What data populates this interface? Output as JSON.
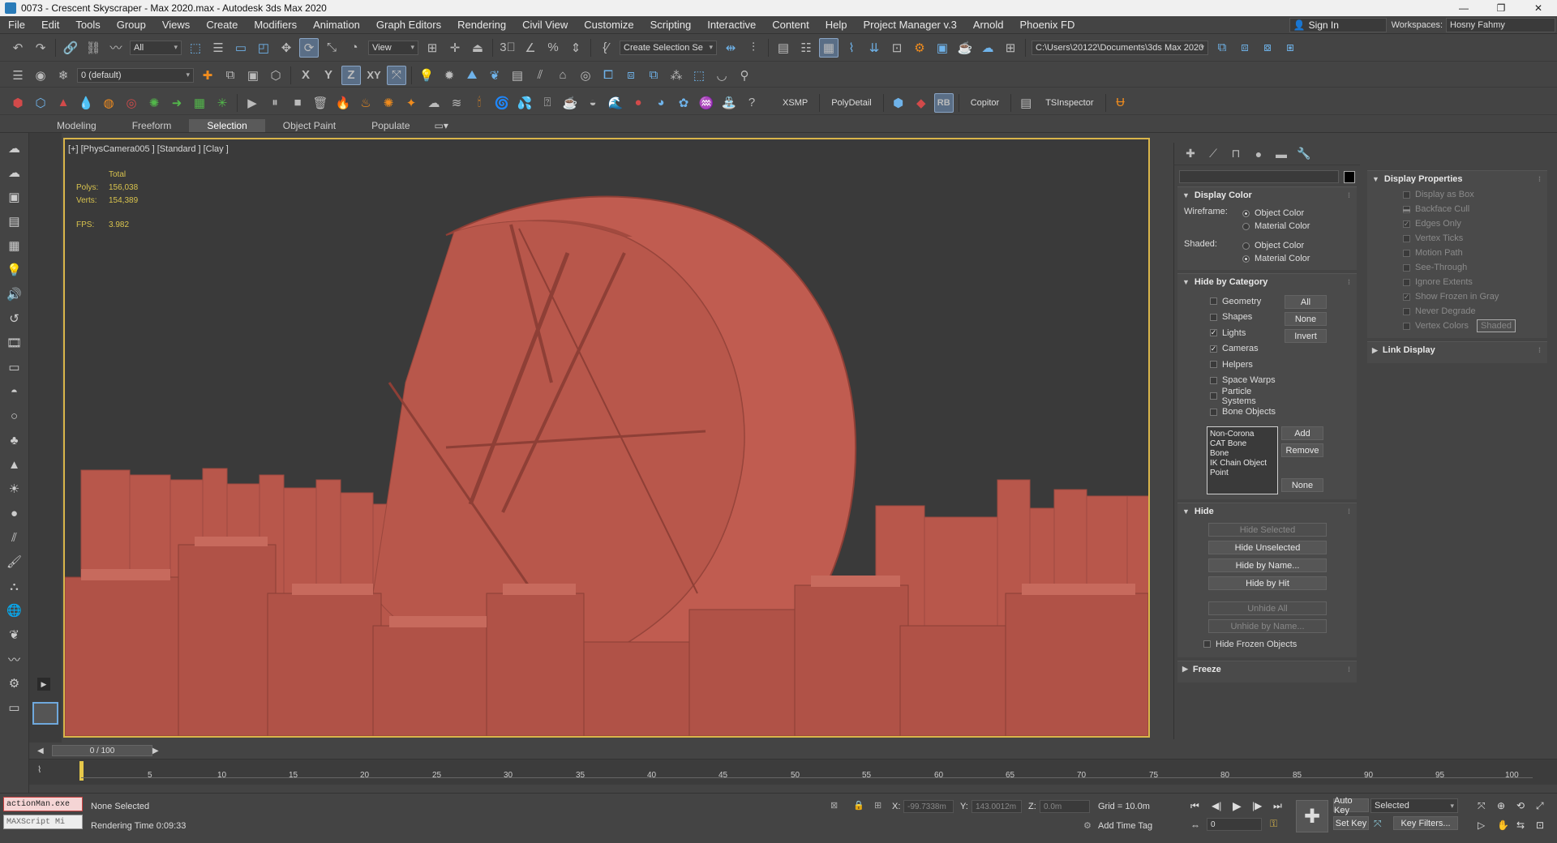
{
  "window": {
    "title": "0073 - Crescent Skyscraper - Max 2020.max - Autodesk 3ds Max 2020",
    "controls": [
      "—",
      "❐",
      "✕"
    ]
  },
  "menu": {
    "items": [
      "File",
      "Edit",
      "Tools",
      "Group",
      "Views",
      "Create",
      "Modifiers",
      "Animation",
      "Graph Editors",
      "Rendering",
      "Civil View",
      "Customize",
      "Scripting",
      "Interactive",
      "Content",
      "Help",
      "Project Manager v.3",
      "Arnold",
      "Phoenix FD"
    ],
    "sign_in": "Sign In",
    "workspaces_label": "Workspaces:",
    "workspace_value": "Hosny Fahmy"
  },
  "toolbar1": {
    "filter_value": "All",
    "view_value": "View",
    "selection_set_value": "Create Selection Se",
    "path_value": "C:\\Users\\20122\\Documents\\3ds Max 2020"
  },
  "toolbar2": {
    "layer_value": "0 (default)",
    "axis_x": "X",
    "axis_y": "Y",
    "axis_z": "Z",
    "axis_xy": "XY"
  },
  "toolbar3": {
    "labels": [
      "XSMP",
      "PolyDetail",
      "Copitor",
      "TSInspector"
    ],
    "rb_label": "RB"
  },
  "ribbon_tabs": {
    "items": [
      "Modeling",
      "Freeform",
      "Selection",
      "Object Paint",
      "Populate"
    ],
    "active": "Selection"
  },
  "viewport": {
    "label": "[+] [PhysCamera005 ] [Standard ] [Clay ]",
    "stats_header": "Total",
    "polys_label": "Polys:",
    "polys_value": "156,038",
    "verts_label": "Verts:",
    "verts_value": "154,389",
    "fps_label": "FPS:",
    "fps_value": "3.982",
    "colors": {
      "building": "#b8574b",
      "background": "#3a3a3a",
      "border": "#d9b54a"
    }
  },
  "command_panel": {
    "display_color": {
      "title": "Display Color",
      "wireframe_label": "Wireframe:",
      "shaded_label": "Shaded:",
      "object_color": "Object Color",
      "material_color": "Material Color"
    },
    "hide_by_category": {
      "title": "Hide by Category",
      "items": [
        {
          "label": "Geometry",
          "checked": false
        },
        {
          "label": "Shapes",
          "checked": false
        },
        {
          "label": "Lights",
          "checked": true
        },
        {
          "label": "Cameras",
          "checked": true
        },
        {
          "label": "Helpers",
          "checked": false
        },
        {
          "label": "Space Warps",
          "checked": false
        },
        {
          "label": "Particle Systems",
          "checked": false
        },
        {
          "label": "Bone Objects",
          "checked": false
        }
      ],
      "btn_all": "All",
      "btn_none": "None",
      "btn_invert": "Invert",
      "list": [
        "Non-Corona",
        "CAT Bone",
        "Bone",
        "IK Chain Object",
        "Point"
      ],
      "btn_add": "Add",
      "btn_remove": "Remove",
      "btn_none2": "None"
    },
    "hide": {
      "title": "Hide",
      "hide_selected": "Hide Selected",
      "hide_unselected": "Hide Unselected",
      "hide_by_name": "Hide by Name...",
      "hide_by_hit": "Hide by Hit",
      "unhide_all": "Unhide All",
      "unhide_by_name": "Unhide by Name...",
      "hide_frozen": "Hide Frozen Objects"
    },
    "freeze": {
      "title": "Freeze"
    }
  },
  "display_properties": {
    "title": "Display Properties",
    "items": [
      {
        "label": "Display as Box",
        "checked": false
      },
      {
        "label": "Backface Cull",
        "checked": "partial"
      },
      {
        "label": "Edges Only",
        "checked": true
      },
      {
        "label": "Vertex Ticks",
        "checked": false
      },
      {
        "label": "Motion Path",
        "checked": false
      },
      {
        "label": "See-Through",
        "checked": false
      },
      {
        "label": "Ignore Extents",
        "checked": false
      },
      {
        "label": "Show Frozen in Gray",
        "checked": true
      },
      {
        "label": "Never Degrade",
        "checked": false
      },
      {
        "label": "Vertex Colors",
        "checked": false
      }
    ],
    "shaded_btn": "Shaded",
    "link_display": "Link Display"
  },
  "timeline": {
    "frame": "0 / 100",
    "ticks": [
      "5",
      "10",
      "15",
      "20",
      "25",
      "30",
      "35",
      "40",
      "45",
      "50",
      "55",
      "60",
      "65",
      "70",
      "75",
      "80",
      "85",
      "90",
      "95",
      "100"
    ]
  },
  "status": {
    "mxs_1": "actionMan.exe",
    "mxs_2": "MAXScript Mi",
    "selection": "None Selected",
    "render_time": "Rendering Time  0:09:33",
    "x_label": "X:",
    "x_value": "-99.7338m",
    "y_label": "Y:",
    "y_value": "143.0012m",
    "z_label": "Z:",
    "z_value": "0.0m",
    "grid": "Grid = 10.0m",
    "add_time_tag": "Add Time Tag",
    "auto_key": "Auto Key",
    "set_key": "Set Key",
    "selected_value": "Selected",
    "key_filters": "Key Filters...",
    "frame_value": "0"
  }
}
